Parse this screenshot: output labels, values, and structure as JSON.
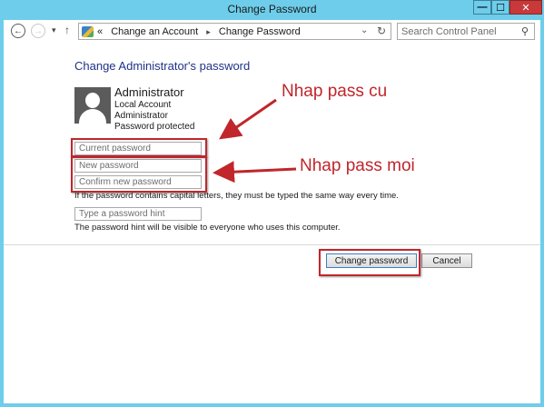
{
  "window": {
    "title": "Change Password",
    "min_glyph": "—",
    "max_glyph": "☐",
    "close_glyph": "✕"
  },
  "nav": {
    "back_glyph": "←",
    "forward_glyph": "→",
    "history_glyph": "▾",
    "up_glyph": "↑",
    "address_prefix": "«",
    "breadcrumbs": [
      "Change an Account",
      "Change Password"
    ],
    "crumb_separator": "▸",
    "dropdown_glyph": "⌄",
    "refresh_glyph": "↻",
    "search_placeholder": "Search Control Panel",
    "search_glyph": "⚲"
  },
  "main": {
    "page_title": "Change Administrator's password",
    "account": {
      "name": "Administrator",
      "details": [
        "Local Account",
        "Administrator",
        "Password protected"
      ]
    },
    "fields": {
      "current_password_placeholder": "Current password",
      "new_password_placeholder": "New password",
      "confirm_password_placeholder": "Confirm new password",
      "hint_placeholder": "Type a password hint"
    },
    "caps_note": "If the password contains capital letters, they must be typed the same way every time.",
    "hint_note": "The password hint will be visible to everyone who uses this computer.",
    "buttons": {
      "change_label": "Change password",
      "cancel_label": "Cancel"
    }
  },
  "annotations": {
    "current_label": "Nhap pass cu",
    "new_label": "Nhap pass moi",
    "color": "#c0262b"
  }
}
